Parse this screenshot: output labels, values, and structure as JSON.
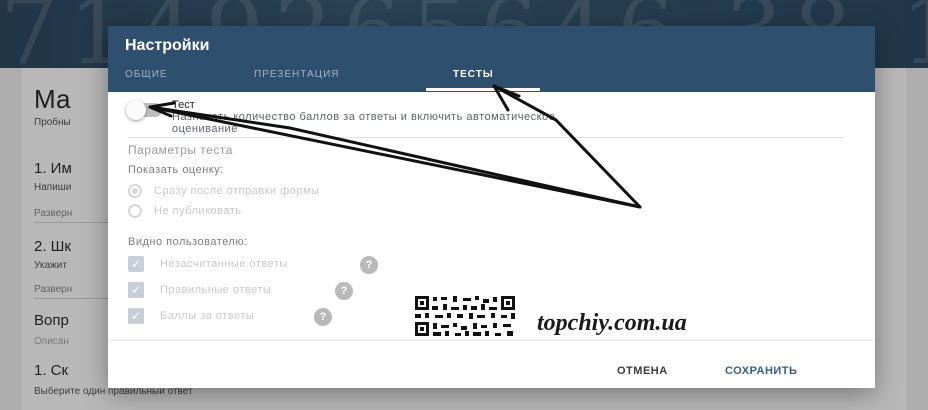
{
  "background": {
    "banner_text": "7149265646 38 15 /",
    "title": "Ма",
    "sub1": "Пробны",
    "q1": "1. Им",
    "q1_hint": "Напиши",
    "expand1": "Разверн",
    "q2": "2. Шк",
    "q2_hint": "Укажит",
    "expand2": "Разверн",
    "section": "Вопр",
    "section_desc": "Описан",
    "q3": "1. Ск",
    "q3_hint": "Выберите один правильный ответ"
  },
  "dialog": {
    "title": "Настройки",
    "tabs": [
      {
        "label": "ОБЩИЕ",
        "active": false
      },
      {
        "label": "ПРЕЗЕНТАЦИЯ",
        "active": false
      },
      {
        "label": "ТЕСТЫ",
        "active": true
      }
    ],
    "quiz_toggle": {
      "label": "Тест",
      "description_line1": "Назначать количество баллов за ответы и включить автоматическое",
      "description_line2": "оценивание",
      "on": false
    },
    "params_heading": "Параметры теста",
    "show_grade_label": "Показать оценку:",
    "grade_options": [
      {
        "label": "Сразу после отправки формы",
        "selected": true
      },
      {
        "label": "Не публиковать",
        "selected": false
      }
    ],
    "visible_label": "Видно пользователю:",
    "visible_options": [
      {
        "label": "Незасчитанные ответы",
        "checked": true
      },
      {
        "label": "Правильные ответы",
        "checked": true
      },
      {
        "label": "Баллы за ответы",
        "checked": true
      }
    ],
    "cancel": "ОТМЕНА",
    "save": "СОХРАНИТЬ"
  },
  "watermark": "topchiy.com.ua",
  "colors": {
    "header": "#2f4f6e",
    "save": "#3a5e82"
  }
}
